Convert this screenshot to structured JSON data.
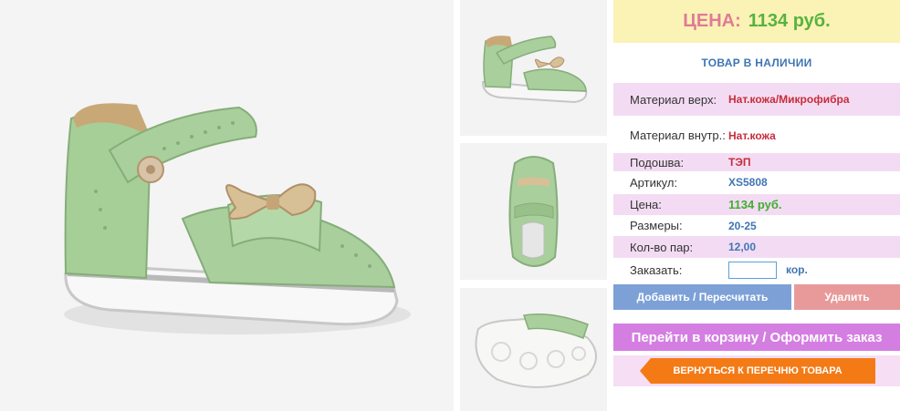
{
  "price_banner": {
    "label": "ЦЕНА:",
    "value": "1134 руб."
  },
  "stock_status": "ТОВАР В НАЛИЧИИ",
  "specs": [
    {
      "key": "Материал верх:",
      "value": "Нат.кожа/Микрофибра"
    },
    {
      "key": "Материал внутр.:",
      "value": "Нат.кожа"
    },
    {
      "key": "Подошва:",
      "value": "ТЭП"
    },
    {
      "key": "Артикул:",
      "value": "XS5808"
    },
    {
      "key": "Цена:",
      "value": "1134 руб."
    },
    {
      "key": "Размеры:",
      "value": "20-25"
    },
    {
      "key": "Кол-во пар:",
      "value": "12,00"
    }
  ],
  "order": {
    "label": "Заказать:",
    "input_value": "",
    "unit": "кор."
  },
  "buttons": {
    "add": "Добавить / Пересчитать",
    "delete": "Удалить",
    "cart": "Перейти в корзину / Оформить заказ",
    "back": "ВЕРНУТЬСЯ К ПЕРЕЧНЮ ТОВАРА"
  },
  "colors": {
    "price_label": "#e07a98",
    "price_value": "#56b33f",
    "banner_bg": "#fbf2b5",
    "row_highlight": "#f3dcf3",
    "add_button": "#7da1d6",
    "delete_button": "#e89a9a",
    "cart_button": "#d47ee2",
    "back_button": "#f47a16",
    "shoe_green": "#a8cf9c",
    "gold_accent": "#c9a877"
  }
}
